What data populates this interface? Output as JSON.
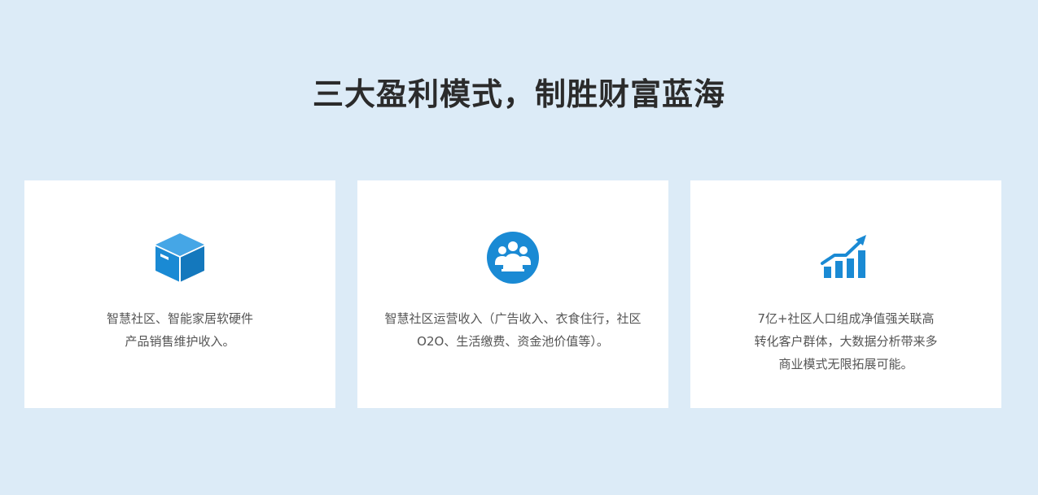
{
  "page": {
    "title": "三大盈利模式，制胜财富蓝海"
  },
  "colors": {
    "background": "#dcebf7",
    "card": "#ffffff",
    "accent": "#1a8ad4",
    "title": "#2b2b2b",
    "text": "#555555"
  },
  "cards": [
    {
      "icon": "box-icon",
      "lines": [
        "智慧社区、智能家居软硬件",
        "产品销售维护收入。"
      ]
    },
    {
      "icon": "users-icon",
      "lines": [
        "智慧社区运营收入（广告收入、衣食住行，社区",
        "O2O、生活缴费、资金池价值等）。"
      ]
    },
    {
      "icon": "growth-chart-icon",
      "lines": [
        "7亿+社区人口组成净值强关联高",
        "转化客户群体，大数据分析带来多",
        "商业模式无限拓展可能。"
      ]
    }
  ]
}
